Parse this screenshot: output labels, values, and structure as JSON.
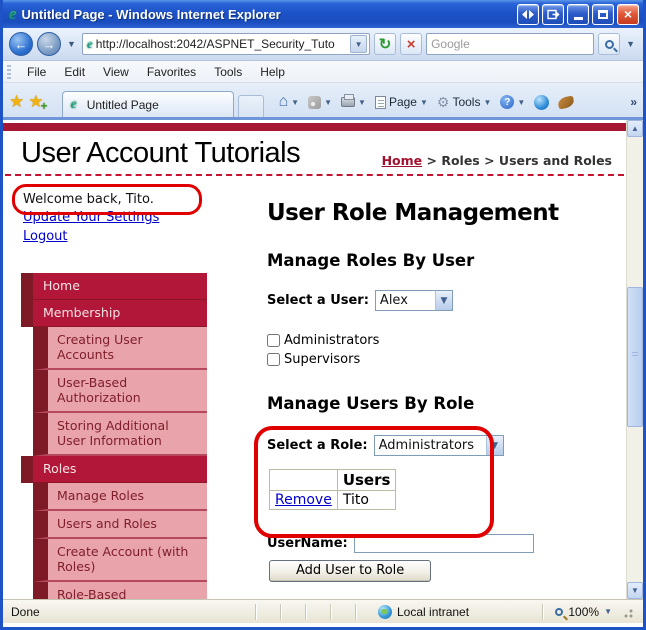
{
  "window": {
    "title": "Untitled Page - Windows Internet Explorer"
  },
  "navbar": {
    "url": "http://localhost:2042/ASPNET_Security_Tuto",
    "search_placeholder": "Google"
  },
  "menubar": {
    "items": [
      "File",
      "Edit",
      "View",
      "Favorites",
      "Tools",
      "Help"
    ]
  },
  "tabbar": {
    "active_tab": "Untitled Page",
    "page_button": "Page",
    "tools_button": "Tools",
    "more_chevron": "»"
  },
  "content": {
    "site_title": "User Account Tutorials",
    "breadcrumb": {
      "home_link": "Home",
      "trail": "> Roles > Users and Roles"
    },
    "welcome_text": "Welcome back, Tito.",
    "settings_link": "Update Your Settings",
    "logout_link": "Logout",
    "menu": [
      {
        "label": "Home",
        "level": "1"
      },
      {
        "label": "Membership",
        "level": "1"
      },
      {
        "label": "Creating User Accounts",
        "level": "2"
      },
      {
        "label": "User-Based Authorization",
        "level": "2"
      },
      {
        "label": "Storing Additional User Information",
        "level": "2"
      },
      {
        "label": "Roles",
        "level": "1"
      },
      {
        "label": "Manage Roles",
        "level": "2"
      },
      {
        "label": "Users and Roles",
        "level": "2"
      },
      {
        "label": "Create Account (with Roles)",
        "level": "2"
      },
      {
        "label": "Role-Based",
        "level": "2"
      }
    ],
    "main": {
      "title": "User Role Management",
      "roles_by_user": {
        "heading": "Manage Roles By User",
        "select_label": "Select a User:",
        "selected_user": "Alex",
        "role_checkboxes": [
          "Administrators",
          "Supervisors"
        ]
      },
      "users_by_role": {
        "heading": "Manage Users By Role",
        "select_label": "Select a Role:",
        "selected_role": "Administrators",
        "table": {
          "action_header": "",
          "users_header": "Users",
          "rows": [
            {
              "action": "Remove",
              "user": "Tito"
            }
          ]
        },
        "username_label": "UserName:",
        "add_button": "Add User to Role"
      }
    }
  },
  "statusbar": {
    "status": "Done",
    "zone": "Local intranet",
    "zoom": "100%"
  },
  "colors": {
    "menu_crimson": "#B21638",
    "menu_maroon": "#7D1A26",
    "menu_pink": "#E9A3AB",
    "top_rule_red": "#A61733",
    "annotation_red": "#E10000",
    "link_blue": "#0000CC",
    "breadcrumb_red": "#A0122E",
    "titlebar_blue": "#1D53C8"
  }
}
